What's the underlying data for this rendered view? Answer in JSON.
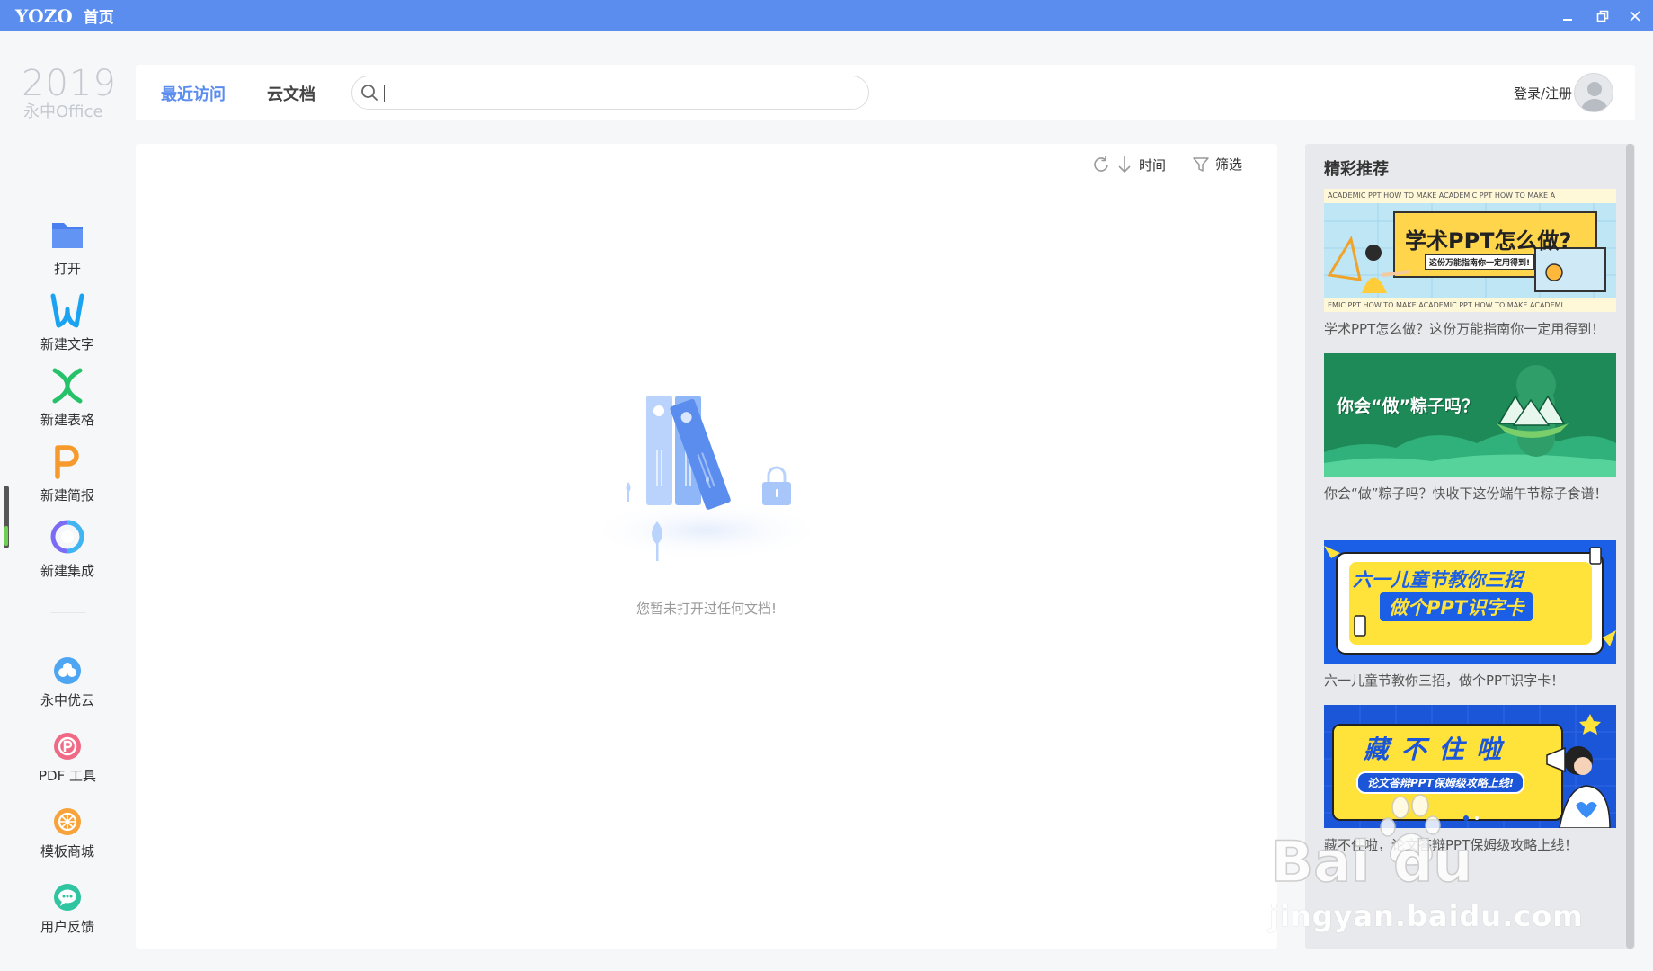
{
  "titlebar": {
    "logo": "YOZO",
    "title": "首页"
  },
  "brand": {
    "year": "2019",
    "name": "永中Office"
  },
  "header": {
    "tabs": [
      {
        "label": "最近访问",
        "active": true
      },
      {
        "label": "云文档",
        "active": false
      }
    ],
    "search": {
      "value": "",
      "placeholder": ""
    },
    "login_label": "登录/注册"
  },
  "sidebar": {
    "items": [
      {
        "label": "打开",
        "icon": "folder-icon",
        "color": "#5b8def"
      },
      {
        "label": "新建文字",
        "icon": "word-icon",
        "color": "#1aa3f0"
      },
      {
        "label": "新建表格",
        "icon": "sheet-icon",
        "color": "#25c26a"
      },
      {
        "label": "新建简报",
        "icon": "slides-icon",
        "color": "#f79a2e"
      },
      {
        "label": "新建集成",
        "icon": "integrated-icon",
        "color": "#7b6cf5"
      }
    ],
    "tools": [
      {
        "label": "永中优云",
        "icon": "cloud-icon",
        "color": "#4ea6f2"
      },
      {
        "label": "PDF 工具",
        "icon": "pdf-icon",
        "color": "#f06a86"
      },
      {
        "label": "模板商城",
        "icon": "template-icon",
        "color": "#f7a23a"
      },
      {
        "label": "用户反馈",
        "icon": "feedback-icon",
        "color": "#2ec5a0"
      }
    ]
  },
  "main": {
    "toolbar": {
      "sort_label": "时间",
      "filter_label": "筛选"
    },
    "empty_text": "您暂未打开过任何文档!"
  },
  "recommend": {
    "title": "精彩推荐",
    "items": [
      {
        "caption": "学术PPT怎么做？这份万能指南你一定用得到！",
        "banner": {
          "headline": "学术PPT怎么做?",
          "subline": "这份万能指南你一定用得到!",
          "ticker_top": "ACADEMIC PPT        HOW TO MAKE ACADEMIC PPT        HOW TO MAKE A",
          "ticker_bottom": "EMIC PPT        HOW TO MAKE ACADEMIC PPT        HOW TO MAKE ACADEMI"
        }
      },
      {
        "caption": "你会“做”粽子吗？快收下这份端午节粽子食谱！",
        "banner": {
          "headline": "你会“做”粽子吗？"
        }
      },
      {
        "caption": "六一儿童节教你三招，做个PPT识字卡！",
        "banner": {
          "headline": "六一儿童节教你三招",
          "subline": "做个PPT识字卡"
        }
      },
      {
        "caption": "藏不住啦，论文答辩PPT保姆级攻略上线！",
        "banner": {
          "headline": "藏 不 住 啦",
          "subline": "论文答辩PPT保姆级攻略上线!"
        }
      }
    ]
  },
  "watermark": {
    "site": "jingyan.baidu.com"
  }
}
